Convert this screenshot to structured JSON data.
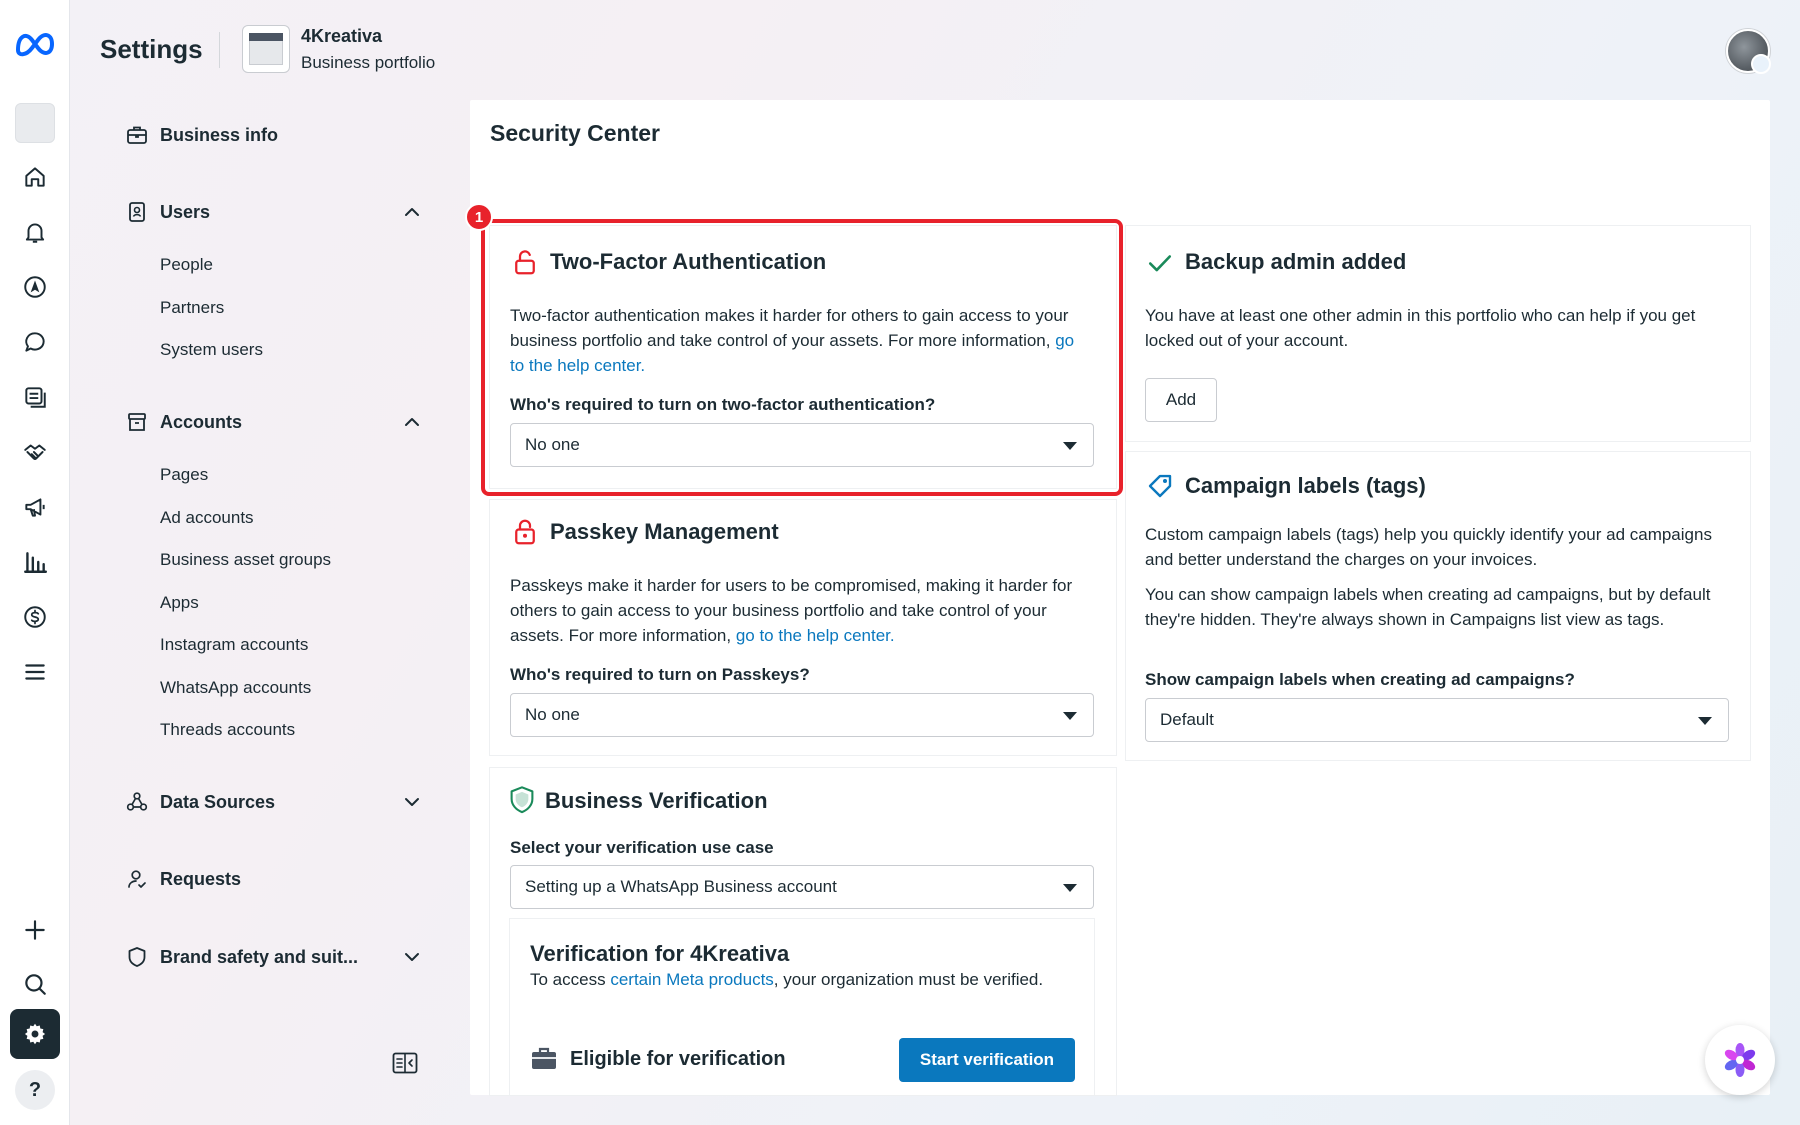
{
  "header": {
    "title": "Settings",
    "portfolio_name": "4Kreativa",
    "portfolio_subtitle": "Business portfolio"
  },
  "rail": {
    "icons": [
      "meta-logo-icon",
      "home-icon",
      "bell-icon",
      "navigation-icon",
      "chat-icon",
      "content-icon",
      "handshake-icon",
      "megaphone-icon",
      "analytics-icon",
      "billing-icon",
      "menu-icon",
      "plus-icon",
      "search-icon",
      "gear-icon",
      "help-icon"
    ],
    "help_label": "?"
  },
  "sidebar": {
    "business_info": "Business info",
    "users": {
      "label": "Users",
      "items": [
        "People",
        "Partners",
        "System users"
      ]
    },
    "accounts": {
      "label": "Accounts",
      "items": [
        "Pages",
        "Ad accounts",
        "Business asset groups",
        "Apps",
        "Instagram accounts",
        "WhatsApp accounts",
        "Threads accounts"
      ]
    },
    "data_sources": "Data Sources",
    "requests": "Requests",
    "brand_safety": "Brand safety and suit..."
  },
  "main": {
    "title": "Security Center",
    "annotation_badge": "1",
    "two_factor": {
      "title": "Two-Factor Authentication",
      "text": "Two-factor authentication makes it harder for others to gain access to your business portfolio and take control of your assets. For more information,",
      "link": "go to the help center.",
      "question": "Who's required to turn on two-factor authentication?",
      "value": "No one"
    },
    "passkey": {
      "title": "Passkey Management",
      "text": "Passkeys make it harder for users to be compromised, making it harder for others to gain access to your business portfolio and take control of your assets. For more information,",
      "link": "go to the help center.",
      "question": "Who's required to turn on Passkeys?",
      "value": "No one"
    },
    "verification": {
      "title": "Business Verification",
      "question": "Select your verification use case",
      "value": "Setting up a WhatsApp Business account",
      "sub_title": "Verification for 4Kreativa",
      "sub_text_pre": "To access",
      "sub_link": "certain Meta products",
      "sub_text_post": ", your organization must be verified.",
      "eligible": "Eligible for verification",
      "button": "Start verification"
    },
    "backup_admin": {
      "title": "Backup admin added",
      "text": "You have at least one other admin in this portfolio who can help if you get locked out of your account.",
      "button": "Add"
    },
    "campaign_labels": {
      "title": "Campaign labels (tags)",
      "text1": "Custom campaign labels (tags) help you quickly identify your ad campaigns and better understand the charges on your invoices.",
      "text2": "You can show campaign labels when creating ad campaigns, but by default they're hidden. They're always shown in Campaigns list view as tags.",
      "question": "Show campaign labels when creating ad campaigns?",
      "value": "Default"
    }
  },
  "colors": {
    "brand_blue": "#0a78be",
    "highlight_red": "#e8222b",
    "text": "#1c2b33",
    "success_green": "#1a8a5a"
  }
}
